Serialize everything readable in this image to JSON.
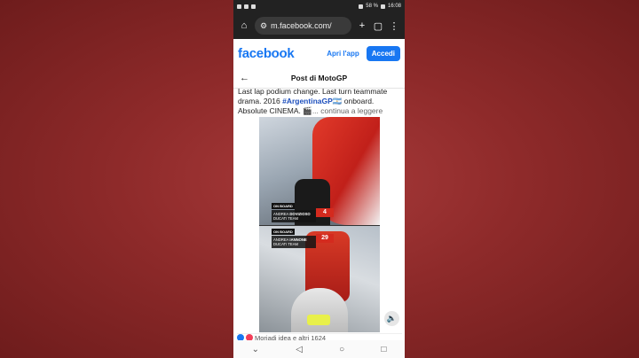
{
  "status_bar": {
    "battery": "58 %",
    "time": "16:08"
  },
  "browser": {
    "url": "m.facebook.com/"
  },
  "fb_header": {
    "logo": "facebook",
    "open_app": "Apri l'app",
    "sign_in": "Accedi"
  },
  "post_header": {
    "title": "Post di MotoGP"
  },
  "post": {
    "text_line1": "Last lap podium change. Last turn teammate",
    "text_line2_pre": "drama. 2016 ",
    "hashtag": "#ArgentinaGP",
    "flag": "🇦🇷",
    "text_line2_post": " onboard.",
    "text_line3": "Absolute CINEMA. 🎬",
    "more": "... continua a leggere"
  },
  "video": {
    "top": {
      "tag": "ON BOARD",
      "first": "ANDREA",
      "last": "DOVIZIOSO",
      "team": "DUCATI TEAM",
      "number": "4"
    },
    "bottom": {
      "tag": "ON BOARD",
      "first": "ANDREA",
      "last": "IANNONE",
      "team": "DUCATI TEAM",
      "number": "29"
    }
  },
  "reactions": {
    "text": "Moriadi idea e altri 1624"
  },
  "colors": {
    "brand": "#1877f2",
    "hashtag": "#1d4fbd"
  }
}
